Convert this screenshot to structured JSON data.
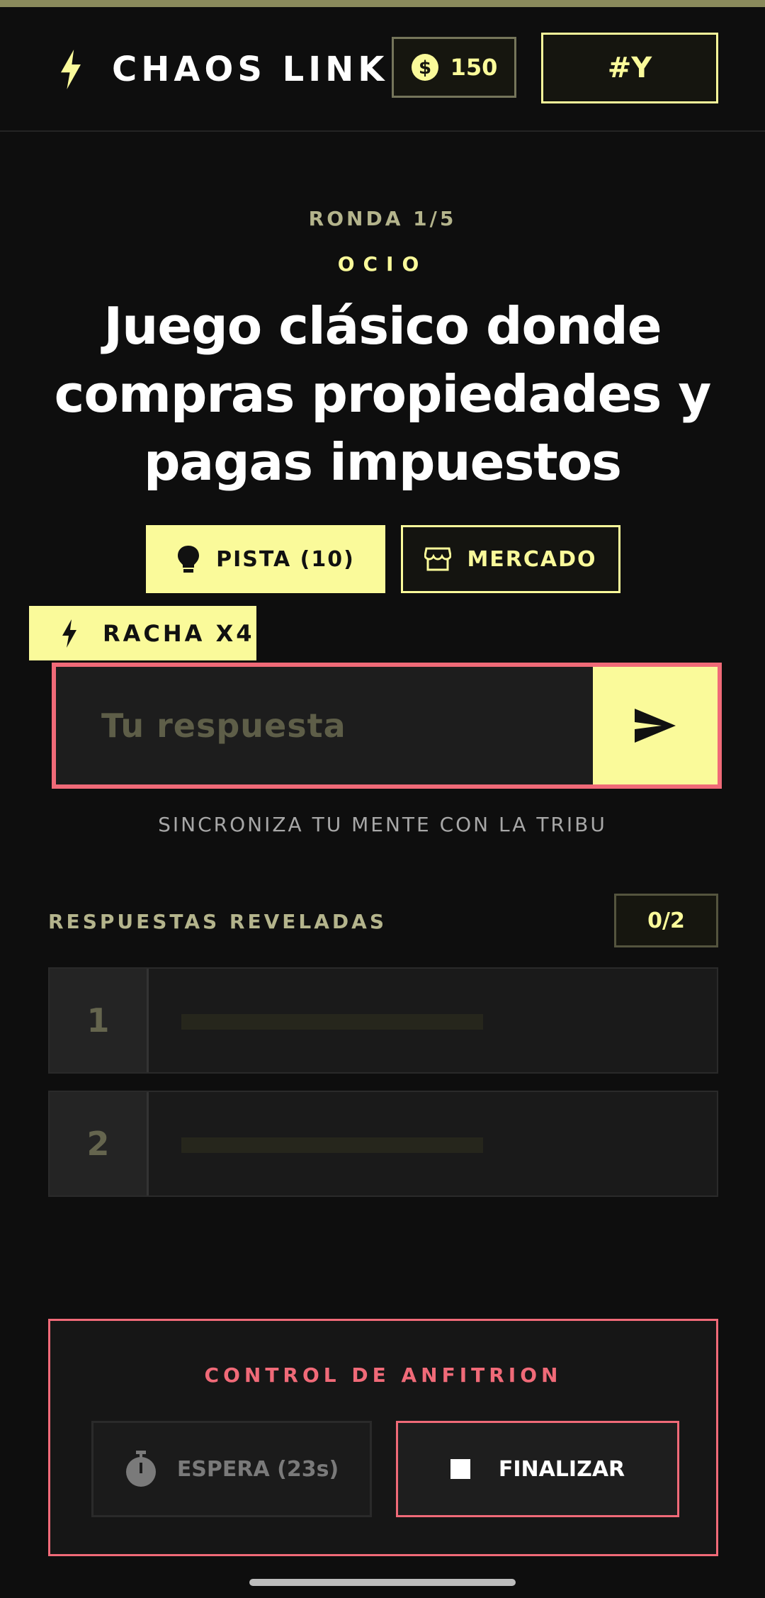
{
  "header": {
    "app_title": "CHAOS LINK",
    "coins": "150",
    "room_code": "#Y",
    "logo_icon": "bolt-icon",
    "coin_icon": "dollar-coin-icon"
  },
  "round": {
    "label": "RONDA 1/5",
    "category": "OCIO",
    "question_lines": [
      "Juego clásico donde",
      "compras propiedades y",
      "pagas impuestos"
    ]
  },
  "actions": {
    "hint_label": "PISTA (10)",
    "hint_icon": "lightbulb-icon",
    "market_label": "MERCADO",
    "market_icon": "storefront-icon"
  },
  "streak": {
    "label": "RACHA X4",
    "icon": "bolt-icon"
  },
  "answer": {
    "placeholder": "Tu respuesta",
    "value": "",
    "send_icon": "send-icon"
  },
  "sync_text": "SINCRONIZA TU MENTE CON LA TRIBU",
  "revealed": {
    "title": "RESPUESTAS REVELADAS",
    "count": "0/2",
    "slots": [
      {
        "number": "1"
      },
      {
        "number": "2"
      }
    ]
  },
  "host_control": {
    "title": "CONTROL DE ANFITRION",
    "wait_label": "ESPERA (23s)",
    "wait_icon": "stopwatch-icon",
    "finish_label": "FINALIZAR",
    "finish_icon": "stop-icon"
  },
  "colors": {
    "accent": "#fafa9a",
    "danger": "#f06a78",
    "background": "#0e0e0e",
    "muted_label": "#b4b48c"
  }
}
